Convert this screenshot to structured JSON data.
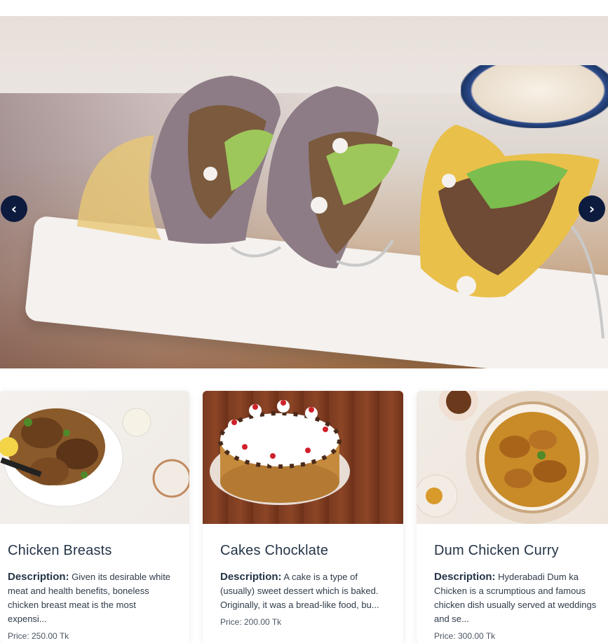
{
  "hero": {
    "prev_label": "‹",
    "next_label": "›"
  },
  "cards": [
    {
      "title": "Chicken Breasts",
      "desc_label": "Description:",
      "desc_text": "Given its desirable white meat and health benefits, boneless chicken breast meat is the most expensi...",
      "price": "Price: 250.00 Tk"
    },
    {
      "title": "Cakes Chocklate",
      "desc_label": "Description:",
      "desc_text": "A cake is a type of (usually) sweet dessert which is baked. Originally, it was a bread-like food, bu...",
      "price": "Price: 200.00 Tk"
    },
    {
      "title": "Dum Chicken Curry",
      "desc_label": "Description:",
      "desc_text": "Hyderabadi Dum ka Chicken is a scrumptious and famous chicken dish usually served at weddings and se...",
      "price": "Price: 300.00 Tk"
    }
  ],
  "colors": {
    "nav_button": "#0d1b3e",
    "title_text": "#243447"
  }
}
